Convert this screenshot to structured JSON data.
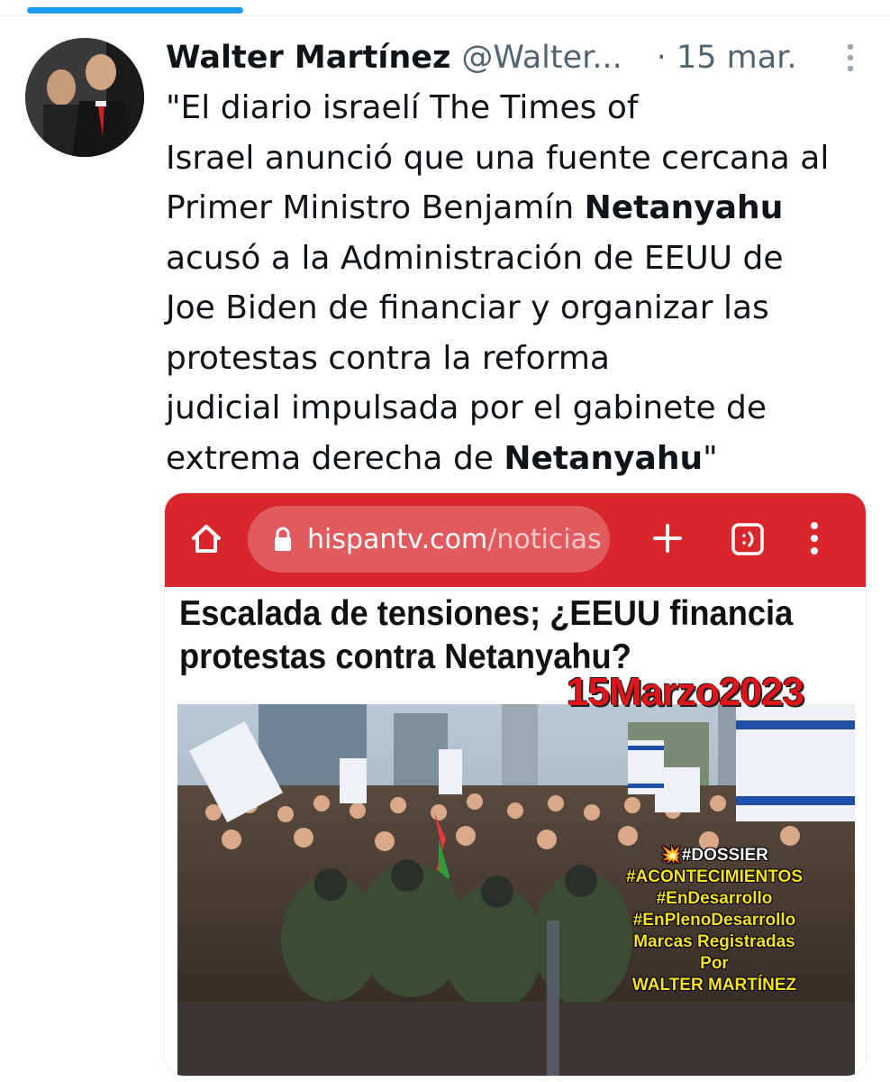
{
  "tweet": {
    "author_name": "Walter Martínez",
    "author_handle": "@Walter...",
    "date": "· 15 mar.",
    "text_lines": [
      [
        "\"El diario israelí The Times of"
      ],
      [
        "Israel anunció que una fuente cercana al"
      ],
      [
        "Primer Ministro Benjamín ",
        "Netanyahu"
      ],
      [
        "acusó a la Administración de EEUU de"
      ],
      [
        "Joe Biden de financiar y organizar las"
      ],
      [
        "protestas contra la reforma"
      ],
      [
        "judicial impulsada por el gabinete de"
      ],
      [
        "extrema derecha de ",
        "Netanyahu",
        "\""
      ]
    ]
  },
  "media": {
    "browser": {
      "url_domain": "hispantv.com",
      "url_path": "/noticias",
      "bar_color": "#d9262b"
    },
    "headline_lines": [
      "Escalada de tensiones; ¿EEUU financia",
      "protestas contra Netanyahu?"
    ],
    "date_stamp": "15Marzo2023",
    "overlay_lines": [
      {
        "text": "💥#DOSSIER",
        "color": "white"
      },
      {
        "text": "#ACONTECIMIENTOS",
        "color": "yellow"
      },
      {
        "text": "#EnDesarrollo",
        "color": "yellow"
      },
      {
        "text": "#EnPlenoDesarrollo",
        "color": "yellow"
      },
      {
        "text": "Marcas Registradas",
        "color": "yellow"
      },
      {
        "text": "Por",
        "color": "yellow"
      },
      {
        "text": "WALTER MARTÍNEZ",
        "color": "yellow"
      }
    ]
  },
  "colors": {
    "accent": "#1d9bf0",
    "muted_text": "#536471",
    "stamp_red": "#e0141b",
    "overlay_yellow": "#f5e21a"
  }
}
